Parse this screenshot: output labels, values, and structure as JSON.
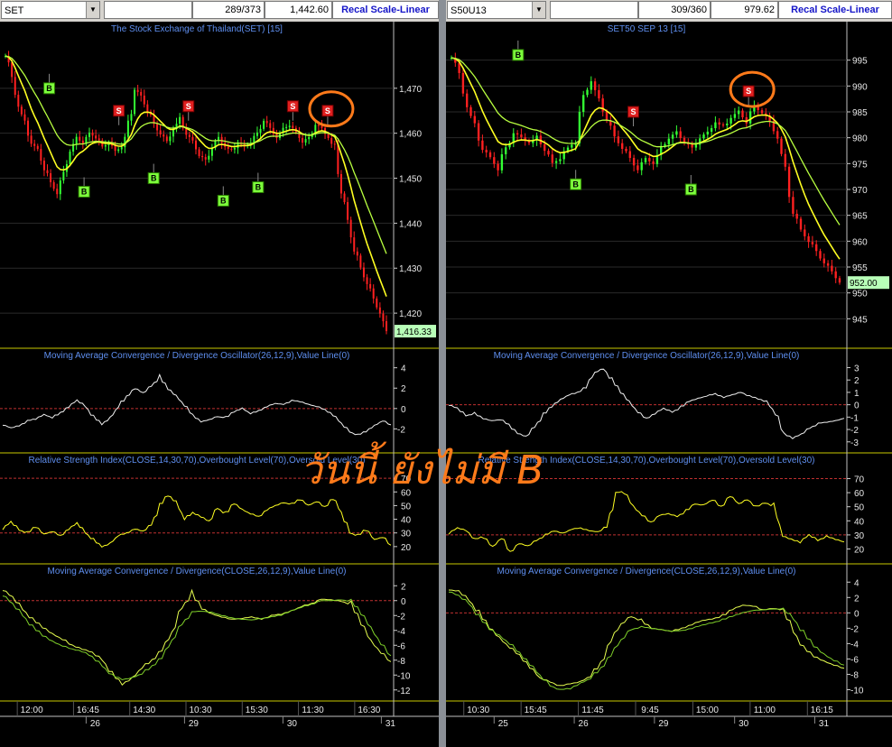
{
  "overlay_text": "วันนี้ ยังไม่มี B",
  "colors": {
    "bg": "#000000",
    "grid": "#2a2a2a",
    "up": "#33ff33",
    "down": "#ff2020",
    "ma_fast": "#ffff22",
    "ma_slow": "#b8ff40",
    "panel_border": "#c8c800",
    "ref_line": "#c03030",
    "title": "#5f8ff0",
    "buy": "#7dff3c",
    "sell": "#e02020",
    "circle": "#ff7a1a",
    "last_box": "#b8ffb8"
  },
  "windows": [
    {
      "id": "L",
      "symbol": "SET",
      "bar_count": "289/373",
      "last_value": "1,442.60",
      "recal_label": "Recal Scale-Linear",
      "main_title": "The Stock Exchange of Thailand(SET) [15]",
      "last_price_label": "1,416.33",
      "panel_titles": [
        "Moving Average Convergence / Divergence Oscillator(26,12,9),Value Line(0)",
        "Relative Strength Index(CLOSE,14,30,70),Overbought Level(70),Oversold Level(30)",
        "Moving Average Convergence / Divergence(CLOSE,26,12,9),Value Line(0)"
      ],
      "time_labels": [
        "12:00",
        "16:45",
        "14:30",
        "10:30",
        "15:30",
        "11:30",
        "16:30"
      ],
      "date_labels": [
        "26",
        "29",
        "30",
        "31"
      ]
    },
    {
      "id": "R",
      "symbol": "S50U13",
      "bar_count": "309/360",
      "last_value": "979.62",
      "recal_label": "Recal Scale-Linear",
      "main_title": "SET50 SEP 13   [15]",
      "last_price_label": "952.00",
      "panel_titles": [
        "Moving Average Convergence / Divergence Oscillator(26,12,9),Value Line(0)",
        "Relative Strength Index(CLOSE,14,30,70),Overbought Level(70),Oversold Level(30)",
        "Moving Average Convergence / Divergence(CLOSE,26,12,9),Value Line(0)"
      ],
      "time_labels": [
        "10:30",
        "15:45",
        "11:45",
        "9:45",
        "15:00",
        "11:00",
        "16:15"
      ],
      "date_labels": [
        "25",
        "26",
        "29",
        "30",
        "31"
      ]
    }
  ],
  "chart_data": [
    {
      "type": "candlestick",
      "title": "The Stock Exchange of Thailand(SET) [15]",
      "ylim": [
        1413,
        1482
      ],
      "yticks": [
        1420,
        1430,
        1440,
        1450,
        1460,
        1470
      ],
      "close_series": [
        1478,
        1472,
        1466,
        1462,
        1458,
        1456,
        1452,
        1449,
        1447,
        1451,
        1456,
        1459,
        1458,
        1460,
        1459,
        1457,
        1458,
        1456,
        1457,
        1461,
        1470,
        1468,
        1465,
        1462,
        1460,
        1458,
        1461,
        1463,
        1460,
        1458,
        1455,
        1454,
        1457,
        1459,
        1457,
        1456,
        1458,
        1457,
        1458,
        1460,
        1463,
        1461,
        1459,
        1461,
        1462,
        1460,
        1458,
        1459,
        1462,
        1461,
        1459,
        1456,
        1448,
        1440,
        1434,
        1430,
        1427,
        1423,
        1420,
        1416
      ],
      "signals": [
        {
          "label": "B",
          "price": 1470
        },
        {
          "label": "B",
          "price": 1447
        },
        {
          "label": "S",
          "price": 1465
        },
        {
          "label": "B",
          "price": 1450
        },
        {
          "label": "S",
          "price": 1466
        },
        {
          "label": "B",
          "price": 1445
        },
        {
          "label": "B",
          "price": 1448
        },
        {
          "label": "S",
          "price": 1466
        },
        {
          "label": "S",
          "price": 1465
        }
      ],
      "highlight": {
        "label": "S",
        "price": 1465
      },
      "panels": [
        {
          "name": "MACD Oscillator",
          "ylim": [
            -4,
            4.5
          ],
          "yticks": [
            -2,
            0,
            2,
            4
          ],
          "ref": 0,
          "values": [
            -1.6,
            -1.9,
            -1.7,
            -1.2,
            -1.0,
            -0.6,
            -0.9,
            -0.4,
            0.2,
            0.8,
            0.2,
            -0.8,
            -1.5,
            -1.0,
            0.2,
            1.2,
            2.0,
            1.5,
            2.2,
            3.1,
            2.0,
            1.2,
            0.3,
            -0.6,
            -1.3,
            -1.1,
            -0.8,
            -0.9,
            -0.3,
            0.0,
            -0.5,
            -0.2,
            0.2,
            0.5,
            0.4,
            0.8,
            0.7,
            0.4,
            0.2,
            -0.1,
            -0.6,
            -1.5,
            -2.3,
            -2.6,
            -2.2,
            -1.7,
            -1.2,
            -1.6
          ]
        },
        {
          "name": "RSI",
          "ylim": [
            10,
            78
          ],
          "yticks": [
            20,
            30,
            40,
            50,
            60,
            70
          ],
          "overbought": 70,
          "oversold": 30,
          "values": [
            33,
            38,
            32,
            30,
            35,
            29,
            31,
            28,
            33,
            37,
            30,
            25,
            20,
            22,
            28,
            30,
            33,
            31,
            36,
            50,
            58,
            52,
            40,
            45,
            42,
            38,
            48,
            44,
            52,
            47,
            44,
            42,
            47,
            50,
            52,
            51,
            55,
            50,
            53,
            49,
            56,
            44,
            30,
            28,
            33,
            25,
            27,
            21
          ]
        },
        {
          "name": "MACD",
          "ylim": [
            -13,
            3
          ],
          "yticks": [
            -12,
            -10,
            -8,
            -6,
            -4,
            -2,
            0,
            2
          ],
          "ref": 0,
          "macd": [
            1.5,
            0.4,
            -1.2,
            -2.5,
            -3.5,
            -4.5,
            -5.2,
            -6.0,
            -6.5,
            -7.0,
            -8.0,
            -9.8,
            -11.2,
            -10.5,
            -9.0,
            -8.0,
            -6.5,
            -4.5,
            -1.0,
            1.0,
            -1.0,
            -1.8,
            -2.2,
            -2.5,
            -2.4,
            -2.2,
            -2.5,
            -2.0,
            -1.8,
            -1.4,
            -0.8,
            -0.4,
            0.2,
            0.1,
            -0.1,
            -0.5,
            -2.8,
            -5.5,
            -7.0,
            -8.2
          ],
          "signal": [
            0.8,
            -0.5,
            -2.0,
            -3.5,
            -4.6,
            -5.5,
            -6.1,
            -6.5,
            -6.8,
            -7.6,
            -8.8,
            -10.0,
            -10.6,
            -10.4,
            -9.8,
            -8.8,
            -7.5,
            -5.5,
            -3.2,
            -1.5,
            -1.4,
            -1.6,
            -2.0,
            -2.3,
            -2.5,
            -2.6,
            -2.4,
            -2.2,
            -1.9,
            -1.4,
            -0.9,
            -0.5,
            0.0,
            0.0,
            0.1,
            -0.1,
            -1.5,
            -3.8,
            -5.8,
            -7.4
          ]
        }
      ]
    },
    {
      "type": "candlestick",
      "title": "SET50 SEP 13   [15]",
      "ylim": [
        940,
        1000
      ],
      "yticks": [
        945,
        950,
        955,
        960,
        965,
        970,
        975,
        980,
        985,
        990,
        995
      ],
      "close_series": [
        996,
        992,
        986,
        982,
        978,
        976,
        974,
        978,
        981,
        980,
        979,
        980,
        978,
        975,
        976,
        978,
        980,
        988,
        991,
        987,
        984,
        980,
        978,
        976,
        974,
        976,
        975,
        978,
        980,
        981,
        979,
        978,
        980,
        981,
        983,
        982,
        984,
        985,
        983,
        986,
        985,
        983,
        980,
        973,
        966,
        962,
        960,
        958,
        956,
        954,
        952
      ],
      "signals": [
        {
          "label": "B",
          "price": 996
        },
        {
          "label": "B",
          "price": 971
        },
        {
          "label": "S",
          "price": 985
        },
        {
          "label": "B",
          "price": 970
        },
        {
          "label": "S",
          "price": 989
        }
      ],
      "highlight": {
        "label": "S",
        "price": 989
      },
      "panels": [
        {
          "name": "MACD Oscillator",
          "ylim": [
            -3.6,
            3.4
          ],
          "yticks": [
            -3,
            -2,
            -1,
            0,
            1,
            2,
            3
          ],
          "ref": 0,
          "values": [
            0.0,
            -0.3,
            -0.9,
            -0.7,
            -1.1,
            -1.3,
            -1.2,
            -1.6,
            -2.3,
            -2.6,
            -1.8,
            -0.8,
            -0.1,
            0.4,
            0.8,
            1.0,
            1.5,
            2.6,
            2.9,
            2.0,
            1.1,
            0.2,
            -0.6,
            -1.1,
            -0.7,
            -0.3,
            -0.6,
            -0.2,
            0.3,
            0.5,
            0.7,
            0.9,
            0.6,
            0.8,
            1.0,
            0.7,
            0.5,
            0.2,
            -0.7,
            -2.3,
            -2.7,
            -2.4,
            -1.9,
            -1.5,
            -1.4,
            -1.3,
            -1.1
          ]
        },
        {
          "name": "RSI",
          "ylim": [
            12,
            78
          ],
          "yticks": [
            20,
            30,
            40,
            50,
            60,
            70
          ],
          "overbought": 70,
          "oversold": 30,
          "values": [
            31,
            35,
            33,
            27,
            29,
            21,
            28,
            18,
            24,
            22,
            26,
            30,
            33,
            31,
            34,
            35,
            33,
            32,
            36,
            60,
            61,
            50,
            44,
            39,
            44,
            45,
            43,
            47,
            52,
            51,
            55,
            50,
            58,
            52,
            55,
            50,
            53,
            50,
            29,
            27,
            25,
            30,
            26,
            29,
            27,
            25
          ]
        },
        {
          "name": "MACD",
          "ylim": [
            -11,
            4.5
          ],
          "yticks": [
            -10,
            -8,
            -6,
            -4,
            -2,
            0,
            2,
            4
          ],
          "ref": 0,
          "macd": [
            3.0,
            2.8,
            1.6,
            0.0,
            -1.8,
            -3.3,
            -4.5,
            -5.5,
            -7.0,
            -8.5,
            -9.0,
            -9.5,
            -9.2,
            -9.0,
            -8.2,
            -6.5,
            -3.5,
            -1.5,
            -0.5,
            -1.0,
            -2.0,
            -2.2,
            -2.4,
            -2.0,
            -1.5,
            -1.0,
            -0.8,
            -0.4,
            0.5,
            1.0,
            0.9,
            0.4,
            0.6,
            0.3,
            -2.5,
            -4.5,
            -5.6,
            -6.3,
            -6.8,
            -7.2
          ],
          "signal": [
            2.8,
            2.2,
            1.2,
            -0.5,
            -2.0,
            -3.0,
            -4.0,
            -5.2,
            -6.6,
            -8.2,
            -9.5,
            -10.0,
            -9.8,
            -9.2,
            -8.5,
            -7.2,
            -5.4,
            -3.6,
            -2.2,
            -1.8,
            -2.0,
            -2.2,
            -2.4,
            -2.3,
            -2.0,
            -1.6,
            -1.3,
            -0.9,
            -0.4,
            0.0,
            0.3,
            0.4,
            0.5,
            0.5,
            -0.8,
            -2.6,
            -4.2,
            -5.4,
            -6.2,
            -6.8
          ]
        }
      ]
    }
  ]
}
